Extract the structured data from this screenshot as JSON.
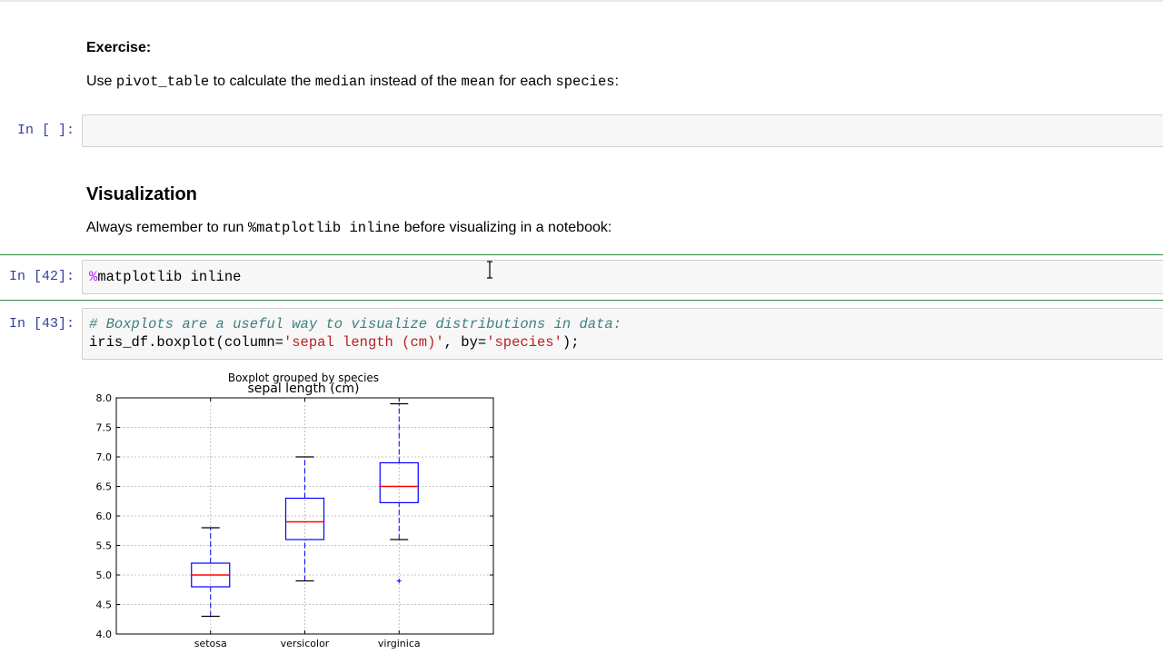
{
  "exercise": {
    "title": "Exercise:",
    "text_1": "Use ",
    "code_1": "pivot_table",
    "text_2": " to calculate the ",
    "code_2": "median",
    "text_3": " instead of the ",
    "code_3": "mean",
    "text_4": " for each ",
    "code_4": "species",
    "text_5": ":"
  },
  "cells": {
    "empty": {
      "prompt": "In [ ]:"
    },
    "c42": {
      "prompt": "In [42]:",
      "magic": "%",
      "code": "matplotlib inline"
    },
    "c43": {
      "prompt": "In [43]:",
      "comment": "# Boxplots are a useful way to visualize distributions in data:",
      "line2_a": "iris_df.boxplot(column=",
      "line2_str1": "'sepal length (cm)'",
      "line2_b": ", by=",
      "line2_str2": "'species'",
      "line2_c": ");"
    }
  },
  "visualization": {
    "title": "Visualization",
    "text_1": "Always remember to run ",
    "code_1": "%matplotlib inline",
    "text_2": " before visualizing in a notebook:"
  },
  "chart_data": {
    "type": "box",
    "suptitle": "Boxplot grouped by species",
    "title": "sepal length (cm)",
    "categories": [
      "setosa",
      "versicolor",
      "virginica"
    ],
    "ylim": [
      4.0,
      8.0
    ],
    "yticks": [
      "4.0",
      "4.5",
      "5.0",
      "5.5",
      "6.0",
      "6.5",
      "7.0",
      "7.5",
      "8.0"
    ],
    "grid": true,
    "boxes": [
      {
        "name": "setosa",
        "whisker_low": 4.3,
        "q1": 4.8,
        "median": 5.0,
        "q3": 5.2,
        "whisker_high": 5.8,
        "outliers": []
      },
      {
        "name": "versicolor",
        "whisker_low": 4.9,
        "q1": 5.6,
        "median": 5.9,
        "q3": 6.3,
        "whisker_high": 7.0,
        "outliers": []
      },
      {
        "name": "virginica",
        "whisker_low": 5.6,
        "q1": 6.225,
        "median": 6.5,
        "q3": 6.9,
        "whisker_high": 7.9,
        "outliers": [
          4.9
        ]
      }
    ],
    "colors": {
      "box": "#0000ff",
      "median": "#ff0000",
      "whisker": "#0000ff",
      "cap": "#000000",
      "grid": "#b0b0b0"
    }
  }
}
